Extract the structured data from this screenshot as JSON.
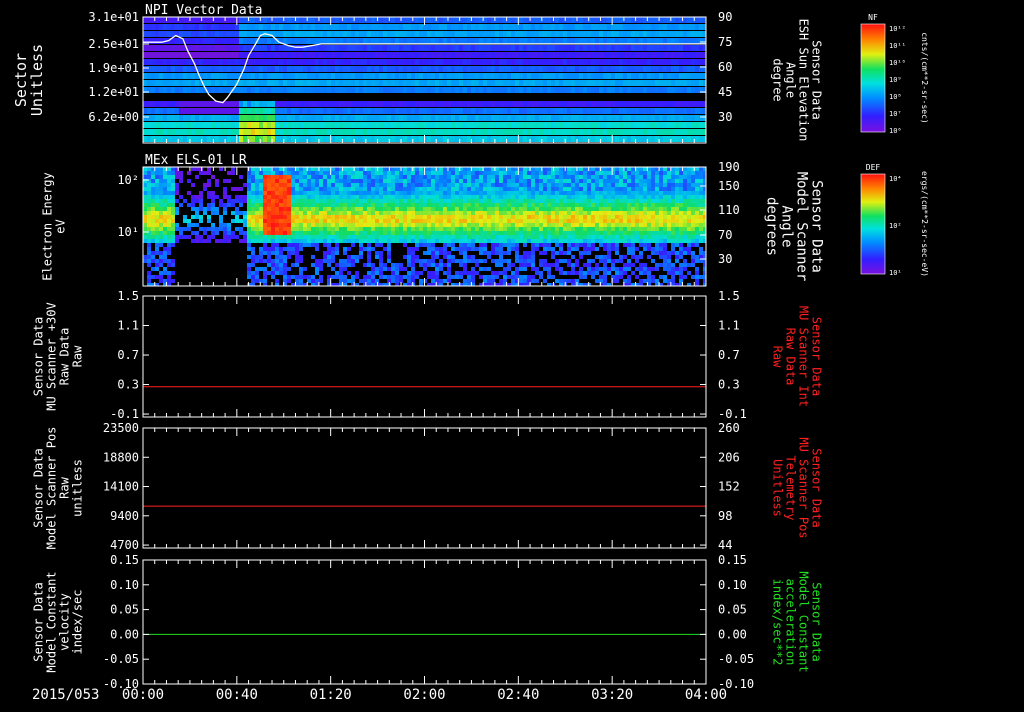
{
  "date_label": "2015/053",
  "x_ticks": [
    "00:00",
    "00:40",
    "01:20",
    "02:00",
    "02:40",
    "03:20",
    "04:00"
  ],
  "chart_data": [
    {
      "type": "heatmap",
      "title": "NPI Vector Data",
      "ylabel": [
        "Sector",
        "Unitless"
      ],
      "yticks": [
        "3.1e+01",
        "2.5e+01",
        "1.9e+01",
        "1.2e+01",
        "6.2e+00"
      ],
      "right_label": [
        "Sensor Data",
        "ESH Sun Elevation",
        "Angle",
        "degree"
      ],
      "right_label_color": "#ffffff",
      "right_ticks": [
        "90",
        "75",
        "60",
        "45",
        "30"
      ],
      "right_range": [
        15,
        90
      ],
      "overlay_series": {
        "name": "ESH Sun Elevation Angle",
        "color": "#ffffff",
        "x_minutes": [
          0,
          6,
          8,
          11,
          14,
          17,
          19,
          22,
          24,
          26,
          28,
          31,
          34,
          36,
          40,
          43,
          45,
          48,
          50,
          52,
          55,
          58,
          62,
          65,
          68,
          72,
          76,
          80,
          240
        ],
        "y_degrees": [
          75,
          75,
          75,
          76,
          79,
          77,
          70,
          62,
          55,
          49,
          44,
          40,
          39,
          42,
          50,
          59,
          67,
          74,
          79,
          80,
          79,
          75,
          73,
          72,
          72,
          73,
          74,
          74,
          74
        ]
      },
      "colorbar": {
        "label": "NF",
        "unit": "cnts/(cm**2-sr-sec)",
        "ticks": [
          "10¹²",
          "10¹¹",
          "10¹⁰",
          "10⁹",
          "10⁸",
          "10⁷",
          "10⁶"
        ]
      }
    },
    {
      "type": "heatmap",
      "title": "MEx ELS-01 LR",
      "ylabel": [
        "Electron Energy",
        "eV"
      ],
      "yticks": [
        "10²",
        "10¹"
      ],
      "right_label": [
        "Sensor Data",
        "Model Scanner",
        "Angle",
        "degrees"
      ],
      "right_label_color": "#ffffff",
      "right_ticks": [
        "190",
        "150",
        "110",
        "70",
        "30"
      ],
      "right_range": [
        10,
        190
      ],
      "colorbar": {
        "label": "DEF",
        "unit": "ergs/(cm**2-sr-sec-eV)",
        "ticks": [
          "10⁴",
          "10²",
          "10¹"
        ]
      }
    },
    {
      "type": "line",
      "ylabel": [
        "Sensor Data",
        "MU Scanner +30V",
        "Raw Data",
        "Raw"
      ],
      "yticks": [
        "1.5",
        "1.1",
        "0.7",
        "0.3",
        "-0.1"
      ],
      "ylim": [
        -0.5,
        1.5
      ],
      "right_label": [
        "Sensor Data",
        "MU Scanner Int",
        "Raw Data",
        "Raw"
      ],
      "right_label_color": "#ff2020",
      "right_ticks": [
        "1.5",
        "1.1",
        "0.7",
        "0.3",
        "-0.1"
      ],
      "series": [
        {
          "color": "#ff2020",
          "x_minutes": [
            0,
            240
          ],
          "values": [
            0.0,
            0.0
          ]
        }
      ]
    },
    {
      "type": "line",
      "ylabel": [
        "Sensor Data",
        "Model Scanner Pos",
        "Raw",
        "unitless"
      ],
      "yticks": [
        "23500",
        "18800",
        "14100",
        "9400",
        "4700"
      ],
      "ylim": [
        0,
        23500
      ],
      "right_label": [
        "Sensor Data",
        "MU Scanner Pos",
        "Telemetry",
        "Unitless"
      ],
      "right_label_color": "#ff2020",
      "right_ticks": [
        "260",
        "206",
        "152",
        "98",
        "44"
      ],
      "right_range": [
        0,
        260
      ],
      "series": [
        {
          "color": "#ff2020",
          "x_minutes": [
            0,
            240
          ],
          "values": [
            8200,
            8200
          ]
        }
      ]
    },
    {
      "type": "line",
      "ylabel": [
        "Sensor Data",
        "Model Constant",
        "velocity",
        "index/sec"
      ],
      "yticks": [
        "0.15",
        "0.10",
        "0.05",
        "0.00",
        "-0.05",
        "-0.10"
      ],
      "ylim": [
        -0.1,
        0.15
      ],
      "right_label": [
        "Sensor Data",
        "Model Constant",
        "acceleration",
        "index/sec**2"
      ],
      "right_label_color": "#20e020",
      "right_ticks": [
        "0.15",
        "0.10",
        "0.05",
        "0.00",
        "-0.05",
        "-0.10"
      ],
      "series": [
        {
          "color": "#20e020",
          "x_minutes": [
            0,
            240
          ],
          "values": [
            0.0,
            0.0
          ]
        }
      ]
    }
  ]
}
